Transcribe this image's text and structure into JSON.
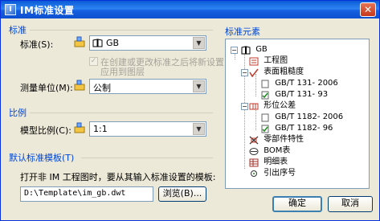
{
  "window": {
    "title": "IM标准设置"
  },
  "standard_group": {
    "title": "标准",
    "standard_label": "标准(S):",
    "standard_value": "GB",
    "reload_checkbox_line1": "在创建或更改标准之后将新设置",
    "reload_checkbox_line2": "应用到图层",
    "unit_label": "测量单位(M):",
    "unit_value": "公制"
  },
  "scale_group": {
    "title": "比例",
    "model_scale_label": "模型比例(C):",
    "model_scale_value": "1:1"
  },
  "template_group": {
    "title": "默认标准模板(T)",
    "description": "打开非 IM 工程图时，要从其输入标准设置的模板:",
    "path_value": "D:\\Template\\im_gb.dwt",
    "browse_label": "浏览(B)..."
  },
  "tree": {
    "title": "标准元素",
    "root": "GB",
    "items": [
      {
        "label": "工程图"
      },
      {
        "label": "表面粗糙度"
      },
      {
        "label": "GB/T 131- 2006"
      },
      {
        "label": "GB/T 131- 93"
      },
      {
        "label": "形位公差"
      },
      {
        "label": "GB/T 1182- 2006"
      },
      {
        "label": "GB/T 1182- 96"
      },
      {
        "label": "零部件特性"
      },
      {
        "label": "BOM表"
      },
      {
        "label": "明细表"
      },
      {
        "label": "引出序号"
      }
    ]
  },
  "buttons": {
    "ok": "确定",
    "cancel": "取消"
  },
  "colors": {
    "group_title": "#0046d5",
    "titlebar": "#1660e1",
    "dialog_bg": "#ece9d8"
  }
}
